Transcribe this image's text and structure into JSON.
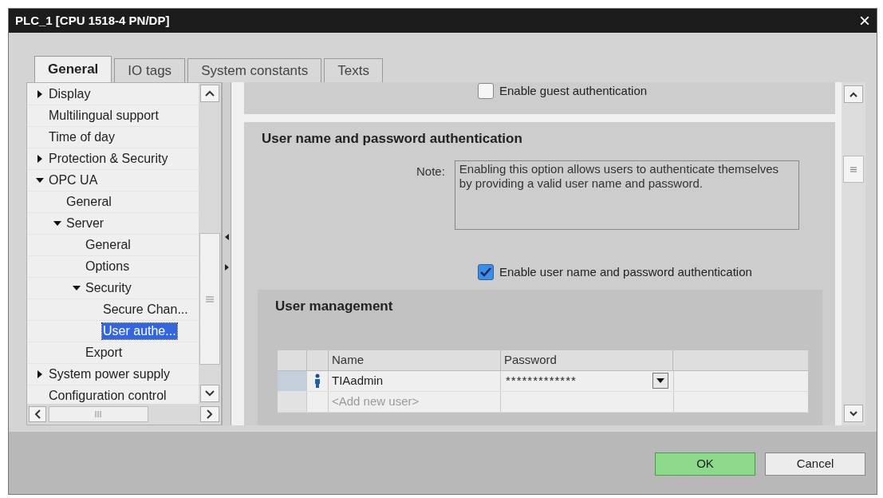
{
  "window": {
    "title": "PLC_1 [CPU 1518-4 PN/DP]",
    "close": "×"
  },
  "tabs": [
    {
      "label": "General",
      "selected": true
    },
    {
      "label": "IO tags",
      "selected": false
    },
    {
      "label": "System constants",
      "selected": false
    },
    {
      "label": "Texts",
      "selected": false
    }
  ],
  "tree": [
    {
      "label": "Display",
      "expanded": false,
      "selected": false
    },
    {
      "label": "Multilingual support",
      "selected": false
    },
    {
      "label": "Time of day",
      "selected": false
    },
    {
      "label": "Protection & Security",
      "expanded": false,
      "selected": false
    },
    {
      "label": "OPC UA",
      "expanded": true,
      "selected": false,
      "children": [
        {
          "label": "General",
          "selected": false
        },
        {
          "label": "Server",
          "expanded": true,
          "selected": false,
          "children": [
            {
              "label": "General",
              "selected": false
            },
            {
              "label": "Options",
              "selected": false
            },
            {
              "label": "Security",
              "expanded": true,
              "selected": false,
              "children": [
                {
                  "label": "Secure Chan...",
                  "selected": false
                },
                {
                  "label": "User authe...",
                  "selected": true
                }
              ]
            },
            {
              "label": "Export",
              "selected": false
            }
          ]
        }
      ]
    },
    {
      "label": "System power supply",
      "expanded": false,
      "selected": false
    },
    {
      "label": "Configuration control",
      "selected": false
    }
  ],
  "guest_authentication": {
    "label": "Enable guest authentication",
    "checked": false
  },
  "user_password_section": {
    "title": "User name and password authentication",
    "note_label": "Note:",
    "note": "Enabling this option allows users to authenticate themselves by providing a valid user name and password.",
    "checkbox": {
      "label": "Enable user name and password authentication",
      "checked": true
    }
  },
  "user_management": {
    "title": "User management",
    "columns": [
      "Name",
      "Password"
    ],
    "rows": [
      {
        "kind": "user",
        "name": "TIAadmin",
        "password": "*************",
        "selected": true
      },
      {
        "kind": "new",
        "name": "<Add new user>",
        "selected": false
      }
    ]
  },
  "buttons": [
    {
      "label": "OK",
      "kind": "primary"
    },
    {
      "label": "Cancel",
      "kind": "secondary"
    }
  ]
}
